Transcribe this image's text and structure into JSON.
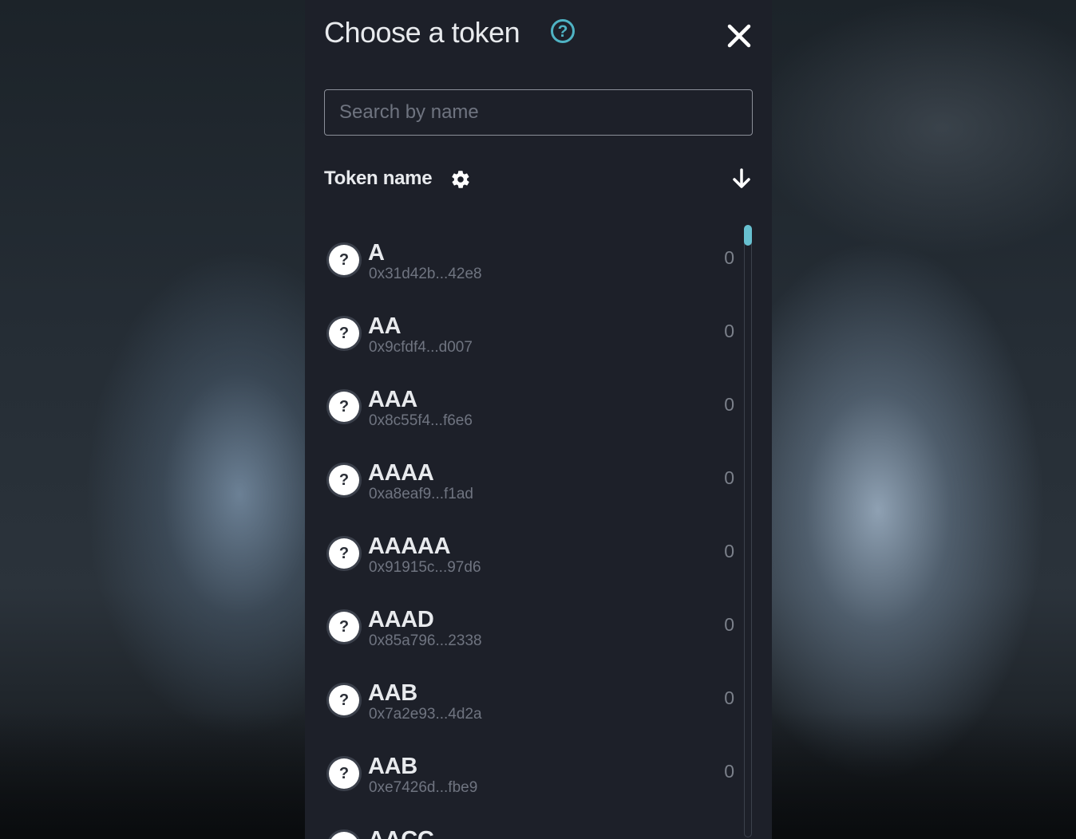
{
  "modal": {
    "title": "Choose a token",
    "help_icon": "question-circle-icon",
    "close_icon": "close-x-icon"
  },
  "search": {
    "placeholder": "Search by name",
    "value": ""
  },
  "sort": {
    "label": "Token name",
    "settings_icon": "gear-icon",
    "direction_icon": "arrow-down-icon"
  },
  "tokens": [
    {
      "symbol": "A",
      "address": "0x31d42b...42e8",
      "balance": "0"
    },
    {
      "symbol": "AA",
      "address": "0x9cfdf4...d007",
      "balance": "0"
    },
    {
      "symbol": "AAA",
      "address": "0x8c55f4...f6e6",
      "balance": "0"
    },
    {
      "symbol": "AAAA",
      "address": "0xa8eaf9...f1ad",
      "balance": "0"
    },
    {
      "symbol": "AAAAA",
      "address": "0x91915c...97d6",
      "balance": "0"
    },
    {
      "symbol": "AAAD",
      "address": "0x85a796...2338",
      "balance": "0"
    },
    {
      "symbol": "AAB",
      "address": "0x7a2e93...4d2a",
      "balance": "0"
    },
    {
      "symbol": "AAB",
      "address": "0xe7426d...fbe9",
      "balance": "0"
    },
    {
      "symbol": "AACC",
      "address": "",
      "balance": ""
    }
  ],
  "token_icon_glyph": "?",
  "colors": {
    "accent": "#4fb3c4",
    "modal_bg": "#1d2029",
    "text": "#e8eaed",
    "muted": "#6f7480"
  }
}
